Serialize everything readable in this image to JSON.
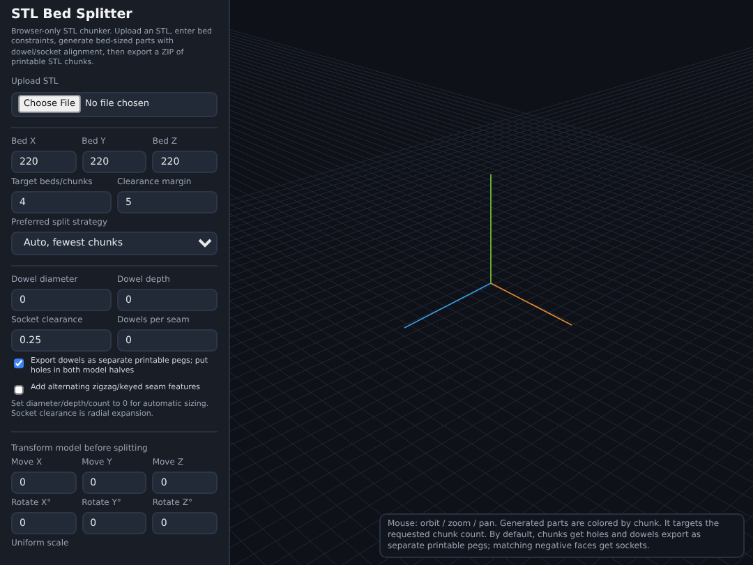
{
  "sidebar": {
    "title": "STL Bed Splitter",
    "description": "Browser-only STL chunker. Upload an STL, enter bed constraints, generate bed-sized parts with dowel/socket alignment, then export a ZIP of printable STL chunks.",
    "upload": {
      "label": "Upload STL",
      "button": "Choose File",
      "status": "No file chosen"
    },
    "bed_fields": [
      {
        "label": "Bed X",
        "value": "220"
      },
      {
        "label": "Bed Y",
        "value": "220"
      },
      {
        "label": "Bed Z",
        "value": "220"
      }
    ],
    "target_fields": [
      {
        "label": "Target beds/chunks",
        "value": "4"
      },
      {
        "label": "Clearance margin",
        "value": "5"
      }
    ],
    "strategy": {
      "label": "Preferred split strategy",
      "value": "Auto, fewest chunks"
    },
    "dowel_fields": [
      {
        "label": "Dowel diameter",
        "value": "0"
      },
      {
        "label": "Dowel depth",
        "value": "0"
      }
    ],
    "socket_fields": [
      {
        "label": "Socket clearance",
        "value": "0.25"
      },
      {
        "label": "Dowels per seam",
        "value": "0"
      }
    ],
    "options": [
      {
        "label": "Export dowels as separate printable pegs; put holes in both model halves",
        "checked": true
      },
      {
        "label": "Add alternating zigzag/keyed seam features",
        "checked": false
      }
    ],
    "note": "Set diameter/depth/count to 0 for automatic sizing. Socket clearance is radial expansion.",
    "transform_title": "Transform model before splitting",
    "move_fields": [
      {
        "label": "Move X",
        "value": "0"
      },
      {
        "label": "Move Y",
        "value": "0"
      },
      {
        "label": "Move Z",
        "value": "0"
      }
    ],
    "rotate_fields": [
      {
        "label": "Rotate X°",
        "value": "0"
      },
      {
        "label": "Rotate Y°",
        "value": "0"
      },
      {
        "label": "Rotate Z°",
        "value": "0"
      }
    ],
    "scale_label": "Uniform scale"
  },
  "viewport": {
    "info": "Mouse: orbit / zoom / pan. Generated parts are colored by chunk. It targets the requested chunk count. By default, chunks get holes and dowels export as separate printable pegs; matching negative faces get sockets."
  }
}
